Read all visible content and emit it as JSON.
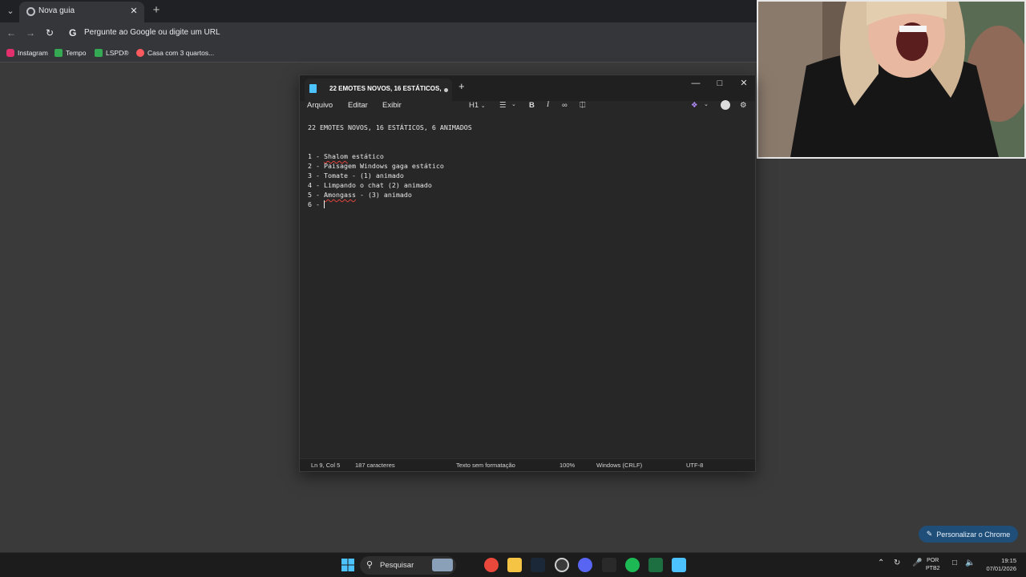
{
  "chrome": {
    "tab_title": "Nova guia",
    "omnibox_placeholder": "Pergunte ao Google ou digite um URL",
    "bookmarks": [
      {
        "label": "Instagram",
        "icon": "instagram-icon",
        "color": "#e1306c"
      },
      {
        "label": "Tempo",
        "icon": "sheets-icon",
        "color": "#34a853"
      },
      {
        "label": "LSPD®",
        "icon": "sheets-icon",
        "color": "#34a853"
      },
      {
        "label": "Casa com 3 quartos...",
        "icon": "airbnb-icon",
        "color": "#ff5a5f"
      }
    ],
    "personalize_label": "Personalizar o Chrome"
  },
  "notepad": {
    "tab_title": "22 EMOTES NOVOS, 16 ESTÁTICOS,",
    "menus": [
      "Arquivo",
      "Editar",
      "Exibir"
    ],
    "heading_selector": "H1",
    "heading": "22 EMOTES NOVOS, 16 ESTÁTICOS, 6 ANIMADOS",
    "lines": [
      {
        "prefix": "1 - ",
        "flagged": "Shalom",
        "rest": " estático"
      },
      {
        "prefix": "2 - ",
        "flagged": "",
        "rest": "Paisagem Windows gaga estático"
      },
      {
        "prefix": "3 - ",
        "flagged": "",
        "rest": "Tomate - (1) animado"
      },
      {
        "prefix": "4 - ",
        "flagged": "",
        "rest": "Limpando o chat (2) animado"
      },
      {
        "prefix": "5 - ",
        "flagged": "Amongass",
        "rest": " - (3) animado"
      },
      {
        "prefix": "6 - ",
        "flagged": "",
        "rest": ""
      }
    ],
    "status": {
      "position": "Ln 9, Col 5",
      "chars": "187 caracteres",
      "format": "Texto sem formatação",
      "zoom": "100%",
      "line_ending": "Windows (CRLF)",
      "encoding": "UTF-8"
    }
  },
  "taskbar": {
    "search_label": "Pesquisar",
    "lang_top": "POR",
    "lang_bottom": "PTB2",
    "time": "19:15",
    "date": "07/01/2026"
  }
}
